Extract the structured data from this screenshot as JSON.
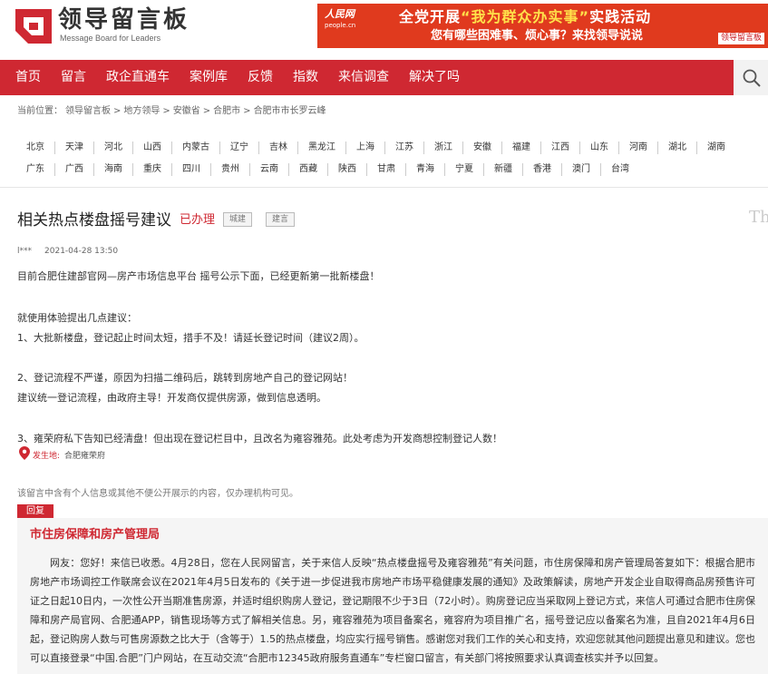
{
  "header": {
    "logo_title": "领导留言板",
    "logo_sub": "Message Board for Leaders",
    "banner_left": "人民网",
    "banner_left_sub": "people.cn",
    "banner_main_pre": "全党开展",
    "banner_main_hl": "“我为群众办实事”",
    "banner_main_post": "实践活动",
    "banner_sub": "您有哪些困难事、烦心事？来找领导说说",
    "banner_right": "领导留言板"
  },
  "nav": {
    "items": [
      "首页",
      "留言",
      "政企直通车",
      "案例库",
      "反馈",
      "指数",
      "来信调查",
      "解决了吗"
    ],
    "search_icon": "search-icon"
  },
  "breadcrumb": {
    "prefix": "当前位置：",
    "items": [
      "领导留言板",
      ">",
      "地方领导",
      ">",
      "安徽省",
      ">",
      "合肥市",
      ">",
      "合肥市市长罗云峰"
    ]
  },
  "provinces": {
    "row1": [
      "北京",
      "天津",
      "河北",
      "山西",
      "内蒙古",
      "辽宁",
      "吉林",
      "黑龙江",
      "上海",
      "江苏",
      "浙江",
      "安徽",
      "福建",
      "江西",
      "山东",
      "河南",
      "湖北",
      "湖南"
    ],
    "row2": [
      "广东",
      "广西",
      "海南",
      "重庆",
      "四川",
      "贵州",
      "云南",
      "西藏",
      "陕西",
      "甘肃",
      "青海",
      "宁夏",
      "新疆",
      "香港",
      "澳门",
      "台湾"
    ]
  },
  "message": {
    "title": "相关热点楼盘摇号建议",
    "status": "已办理",
    "tags": [
      "城建",
      "建言"
    ],
    "author": "l***",
    "date": "2021-04-28 13:50",
    "paragraphs": [
      "目前合肥住建部官网—房产市场信息平台 摇号公示下面，已经更新第一批新楼盘！",
      "就使用体验提出几点建议：",
      "1、大批新楼盘，登记起止时间太短，措手不及！请延长登记时间（建议2周）。",
      "2、登记流程不严谨，原因为扫描二维码后，跳转到房地产自己的登记网站！",
      "建议统一登记流程，由政府主导！开发商仅提供房源，做到信息透明。",
      "3、雍荣府私下告知已经清盘！但出现在登记栏目中，且改名为雍容雅苑。此处考虑为开发商想控制登记人数！"
    ],
    "location_label": "发生地:",
    "location": "合肥雍荣府",
    "notice": "该留言中含有个人信息或其他不便公开展示的内容，仅办理机构可见。"
  },
  "reply": {
    "tab": "回复",
    "org": "市住房保障和房产管理局",
    "text": "网友：您好！来信已收悉。4月28日，您在人民网留言，关于来信人反映“热点楼盘摇号及雍容雅苑”有关问题，市住房保障和房产管理局答复如下：根据合肥市房地产市场调控工作联席会议在2021年4月5日发布的《关于进一步促进我市房地产市场平稳健康发展的通知》及政策解读，房地产开发企业自取得商品房预售许可证之日起10日内，一次性公开当期准售房源，并适时组织购房人登记，登记期限不少于3日（72小时）。购房登记应当采取网上登记方式，来信人可通过合肥市住房保障和房产局官网、合肥通APP，销售现场等方式了解相关信息。另，雍容雅苑为项目备案名，雍容府为项目推广名，摇号登记应以备案名为准，且自2021年4月6日起，登记购房人数与可售房源数之比大于（含等于）1.5的热点楼盘，均应实行摇号销售。感谢您对我们工作的关心和支持，欢迎您就其他问题提出意见和建议。您也可以直接登录“中国.合肥”门户网站，在互动交流“合肥市12345政府服务直通车”专栏窗口留言，有关部门将按照要求认真调查核实并予以回复。"
  },
  "watermark": "Th"
}
